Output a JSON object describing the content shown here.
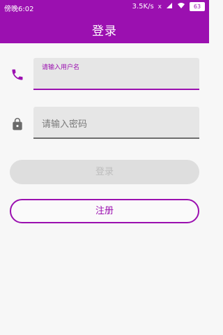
{
  "status_bar": {
    "time": "傍晚6:02",
    "network_speed": "3.5K/s",
    "sim_indicator": "x",
    "battery": "63",
    "icons": [
      "signal-icon",
      "wifi-icon",
      "battery-icon"
    ]
  },
  "app_bar": {
    "title": "登录"
  },
  "form": {
    "username": {
      "icon": "phone-icon",
      "label": "请输入用户名",
      "value": ""
    },
    "password": {
      "icon": "lock-icon",
      "placeholder": "请输入密码",
      "value": ""
    }
  },
  "buttons": {
    "login_label": "登录",
    "register_label": "注册"
  },
  "colors": {
    "primary": "#9b10b0",
    "background": "#f7f7f7",
    "field_bg": "#e6e6e6",
    "disabled_button_bg": "#dedede",
    "disabled_text": "#bdbdbd"
  }
}
